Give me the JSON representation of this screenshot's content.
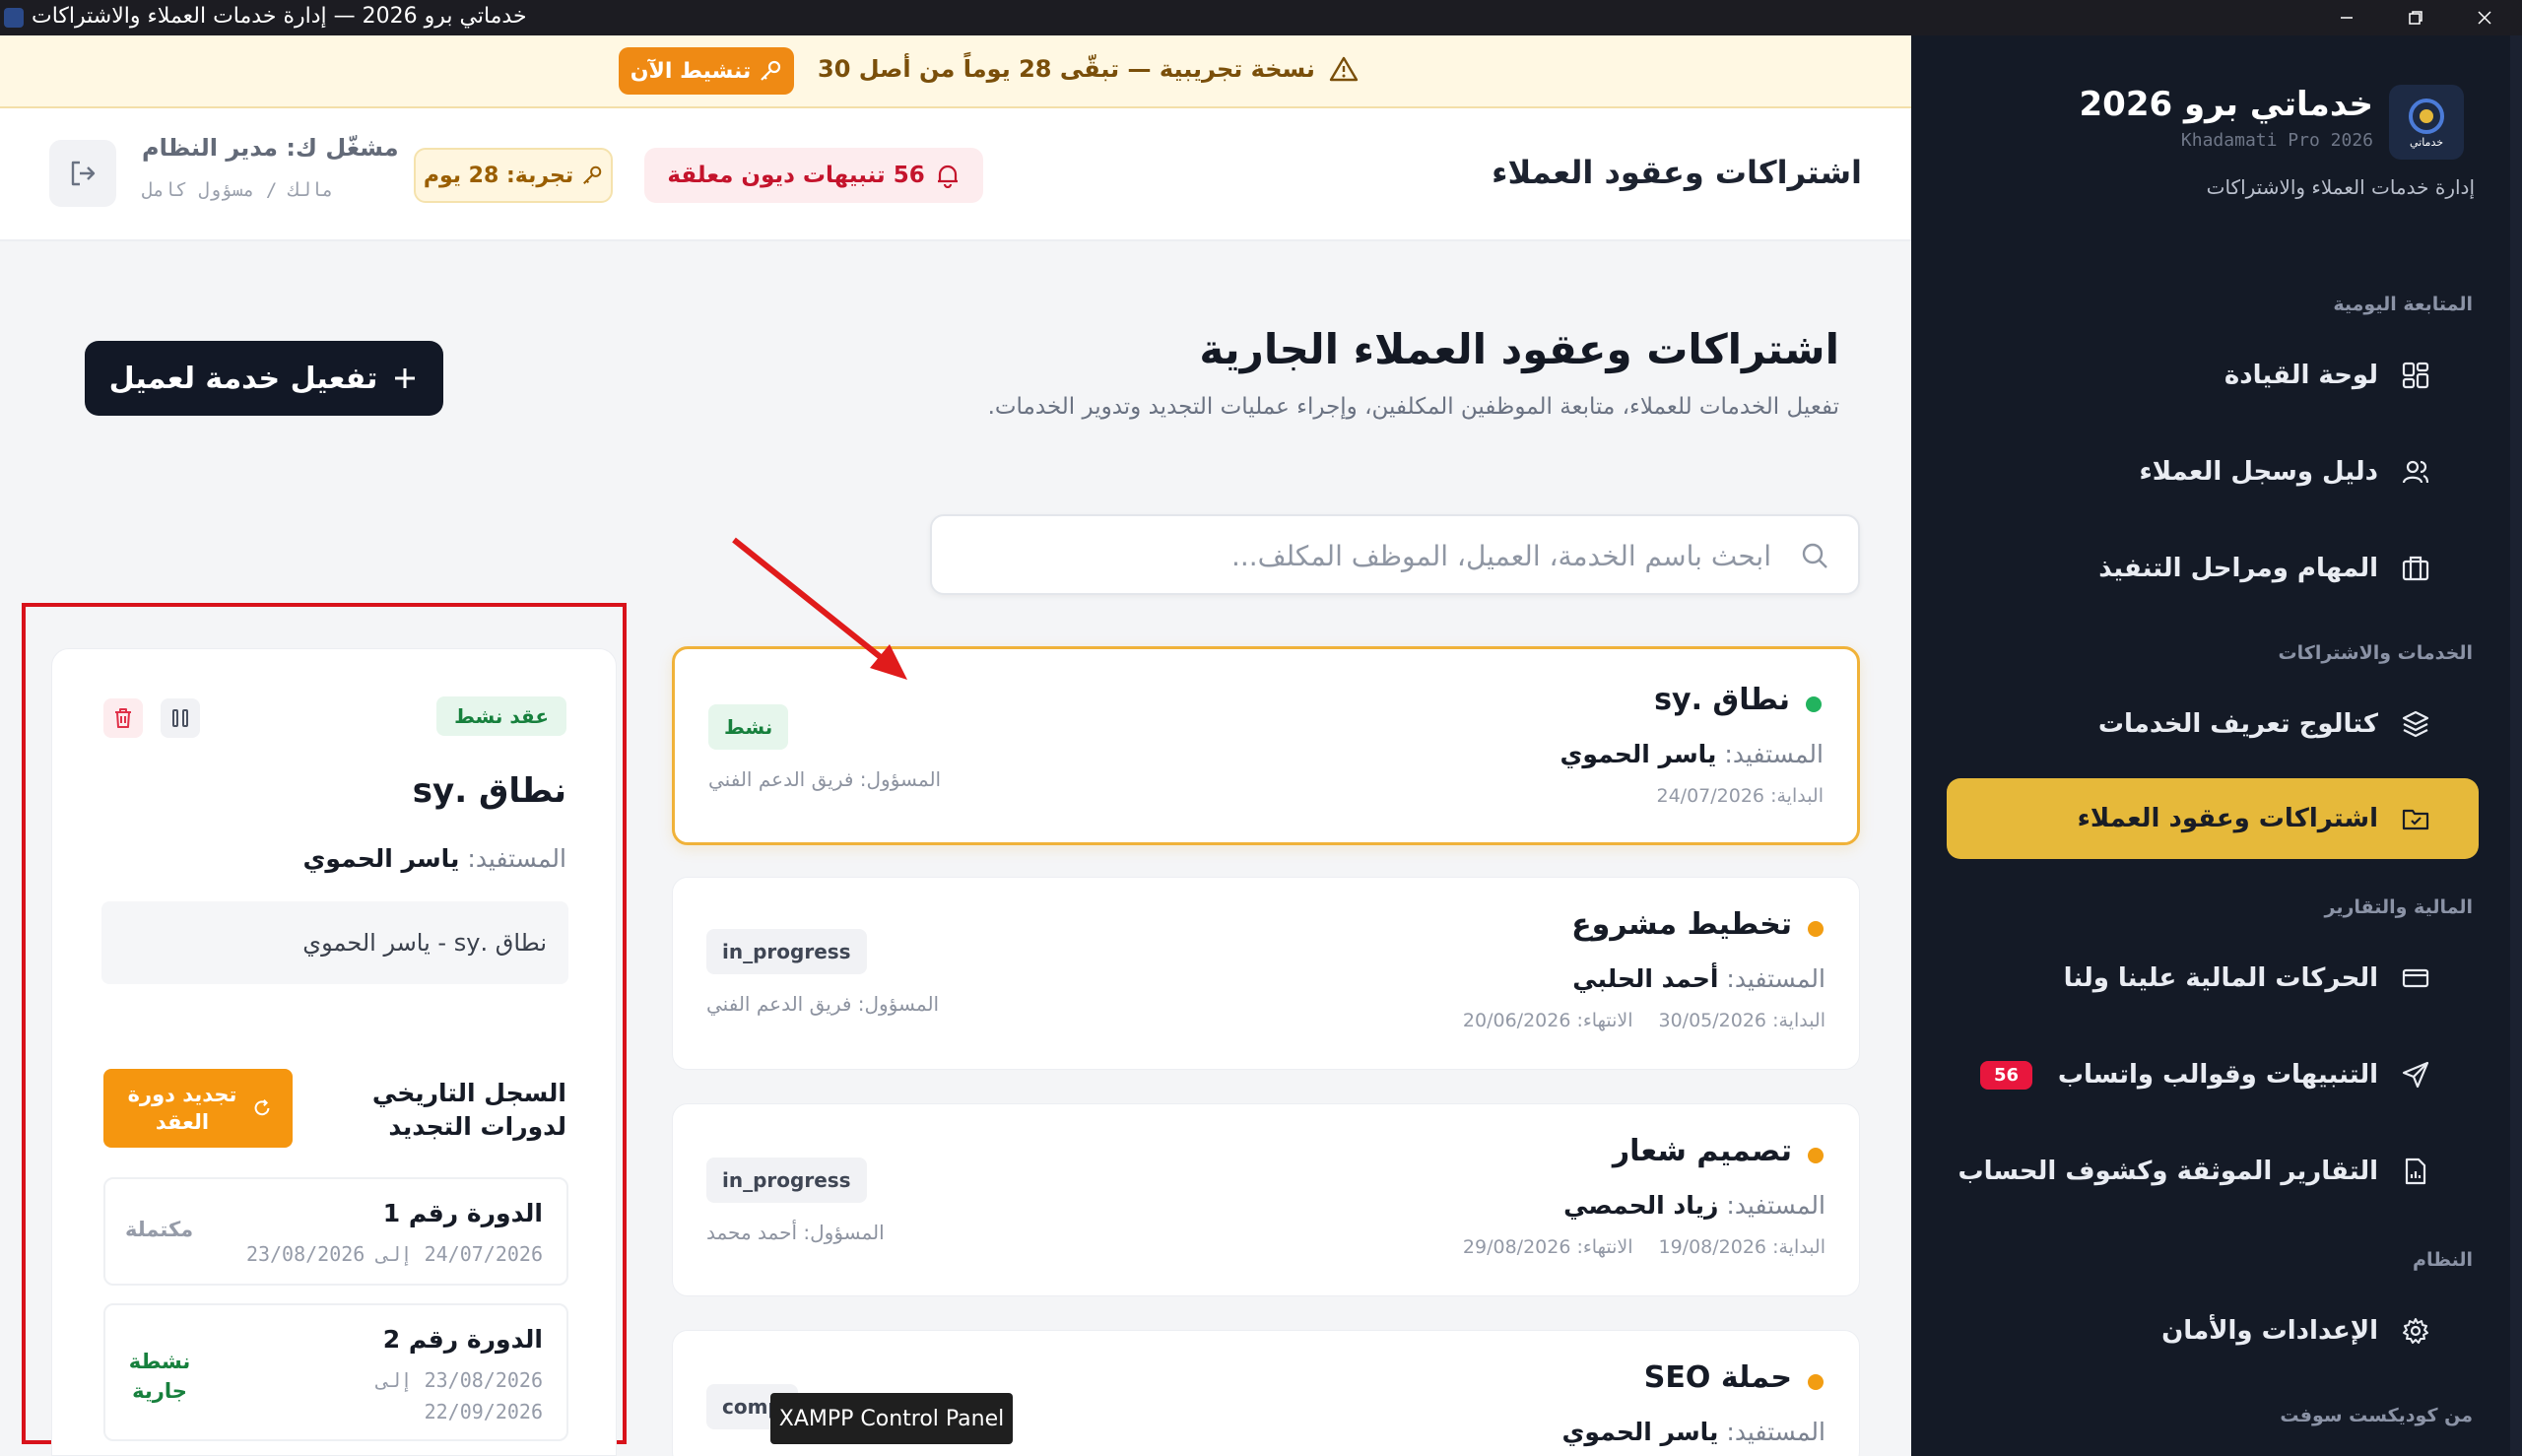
{
  "window": {
    "title": "خدماتي برو 2026 — إدارة خدمات العملاء والاشتراكات"
  },
  "brand": {
    "name": "خدماتي برو 2026",
    "subtitle": "Khadamati Pro 2026",
    "description": "إدارة خدمات العملاء والاشتراكات",
    "logo_text": "خدماتي"
  },
  "sidebar": {
    "sections": [
      {
        "title": "المتابعة اليومية",
        "items": [
          {
            "label": "لوحة القيادة",
            "icon": "dashboard-icon"
          },
          {
            "label": "دليل وسجل العملاء",
            "icon": "users-icon"
          },
          {
            "label": "المهام ومراحل التنفيذ",
            "icon": "briefcase-icon"
          }
        ]
      },
      {
        "title": "الخدمات والاشتراكات",
        "items": [
          {
            "label": "كتالوج تعريف الخدمات",
            "icon": "layers-icon"
          },
          {
            "label": "اشتراكات وعقود العملاء",
            "icon": "folder-check-icon",
            "active": true
          }
        ]
      },
      {
        "title": "المالية والتقارير",
        "items": [
          {
            "label": "الحركات المالية علينا ولنا",
            "icon": "card-icon"
          },
          {
            "label": "التنبيهات وقوالب واتساب",
            "icon": "send-icon",
            "badge": "56"
          },
          {
            "label": "التقارير الموثقة وكشوف الحساب",
            "icon": "report-icon"
          }
        ]
      },
      {
        "title": "النظام",
        "items": [
          {
            "label": "الإعدادات والأمان",
            "icon": "gear-icon"
          }
        ]
      },
      {
        "title": "من كوديكست سوفت",
        "items": []
      }
    ],
    "accent_color": "#e6b93a"
  },
  "banner": {
    "message": "نسخة تجريبية — تبقّى 28 يوماً من أصل 30",
    "button": "تنشيط الآن"
  },
  "header": {
    "title": "اشتراكات وعقود العملاء",
    "alerts": "56 تنبيهات ديون معلقة",
    "trial": "تجربة: 28 يوم",
    "user_name": "مشغّل ك: مدير النظام",
    "user_role": "مالك / مسؤول كامل"
  },
  "page": {
    "heading": "اشتراكات وعقود العملاء الجارية",
    "subheading": "تفعيل الخدمات للعملاء، متابعة الموظفين المكلفين، وإجراء عمليات التجديد وتدوير الخدمات.",
    "activate_button": "تفعيل خدمة لعميل",
    "search_placeholder": "ابحث باسم الخدمة، العميل، الموظف المكلف..."
  },
  "labels": {
    "beneficiary": "المستفيد:",
    "start": "البداية:",
    "end": "الانتهاء:",
    "responsible": "المسؤول:",
    "to": "إلى"
  },
  "contracts": [
    {
      "name": "نطاق .sy",
      "beneficiary": "ياسر الحموي",
      "start": "24/07/2026",
      "end": "",
      "status": "نشط",
      "responsible": "فريق الدعم الفني",
      "dot_color": "#22b35e"
    },
    {
      "name": "تخطيط مشروع",
      "beneficiary": "أحمد الحلبي",
      "start": "30/05/2026",
      "end": "20/06/2026",
      "status": "in_progress",
      "responsible": "فريق الدعم الفني",
      "dot_color": "#f29d12"
    },
    {
      "name": "تصميم شعار",
      "beneficiary": "زياد الحمصي",
      "start": "19/08/2026",
      "end": "29/08/2026",
      "status": "in_progress",
      "responsible": "أحمد محمد",
      "dot_color": "#f29d12"
    },
    {
      "name": "حملة SEO",
      "beneficiary": "ياسر الحموي",
      "start": "",
      "end": "",
      "status": "comp",
      "responsible": "",
      "dot_color": "#f29d12"
    }
  ],
  "detail": {
    "status_badge": "عقد نشط",
    "name": "نطاق .sy",
    "beneficiary": "ياسر الحموي",
    "summary": "نطاق .sy - ياسر الحموي",
    "history_title": "السجل التاريخي لدورات التجديد",
    "renew_button": "تجديد دورة العقد",
    "cycles": [
      {
        "title": "الدورة رقم 1",
        "from": "24/07/2026",
        "to": "23/08/2026",
        "status": "مكتملة",
        "status_color": "#959ba8"
      },
      {
        "title": "الدورة رقم 2",
        "from": "23/08/2026",
        "to": "22/09/2026",
        "status": "نشطة جارية",
        "status_color": "#17803d"
      }
    ]
  },
  "tooltip": "XAMPP Control Panel"
}
